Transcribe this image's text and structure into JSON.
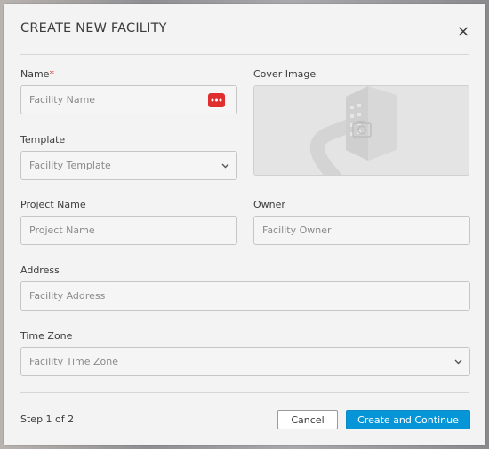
{
  "dialog": {
    "title": "CREATE NEW FACILITY",
    "close_symbol": "×"
  },
  "fields": {
    "name": {
      "label": "Name",
      "required_mark": "*",
      "placeholder": "Facility Name",
      "action_icon": "more-horizontal-icon"
    },
    "cover_image": {
      "label": "Cover Image",
      "icon": "building-camera-placeholder-icon"
    },
    "template": {
      "label": "Template",
      "placeholder": "Facility Template",
      "icon": "chevron-down-icon"
    },
    "project_name": {
      "label": "Project Name",
      "placeholder": "Project Name"
    },
    "owner": {
      "label": "Owner",
      "placeholder": "Facility Owner"
    },
    "address": {
      "label": "Address",
      "placeholder": "Facility Address"
    },
    "time_zone": {
      "label": "Time Zone",
      "placeholder": "Facility Time Zone",
      "icon": "chevron-down-icon"
    }
  },
  "footer": {
    "step": "Step 1 of 2",
    "cancel_label": "Cancel",
    "primary_label": "Create and Continue"
  },
  "colors": {
    "primary": "#0696d7",
    "required": "#d42b2b",
    "action_icon_bg": "#e02d2d"
  }
}
